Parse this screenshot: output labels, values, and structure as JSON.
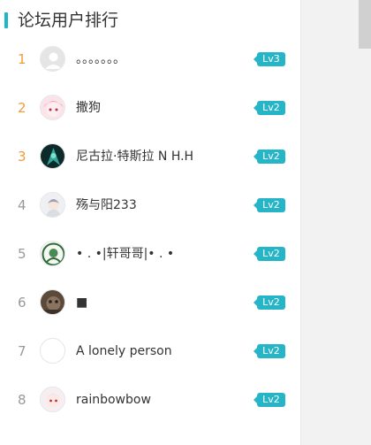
{
  "header": {
    "title": "论坛用户排行"
  },
  "users": [
    {
      "rank": "1",
      "name": "。。。。。。。",
      "level": "Lv3",
      "avatar": "default-avatar-icon"
    },
    {
      "rank": "2",
      "name": "撒狗",
      "level": "Lv2",
      "avatar": "pink-hair-avatar"
    },
    {
      "rank": "3",
      "name": "尼古拉·特斯拉 N H.H",
      "level": "Lv2",
      "avatar": "dark-teal-avatar"
    },
    {
      "rank": "4",
      "name": "殇与阳233",
      "level": "Lv2",
      "avatar": "anime-girl-avatar"
    },
    {
      "rank": "5",
      "name": "• . •|轩哥哥|• . •",
      "level": "Lv2",
      "avatar": "green-sketch-avatar"
    },
    {
      "rank": "6",
      "name": "■",
      "level": "Lv2",
      "avatar": "brown-photo-avatar"
    },
    {
      "rank": "7",
      "name": "A lonely person",
      "level": "Lv2",
      "avatar": "blank-avatar"
    },
    {
      "rank": "8",
      "name": "rainbowbow",
      "level": "Lv2",
      "avatar": "white-hair-avatar"
    }
  ],
  "colors": {
    "accent": "#26b5c7",
    "top_rank": "#f29b3a",
    "rank": "#999999"
  }
}
